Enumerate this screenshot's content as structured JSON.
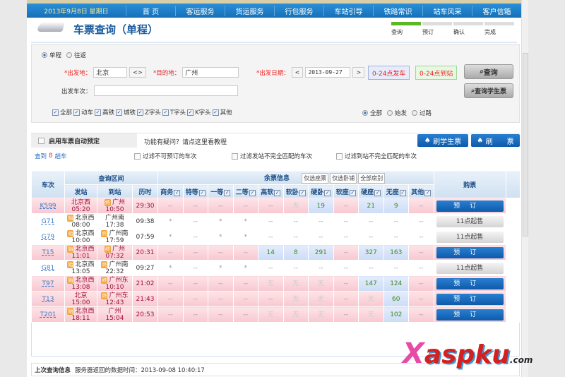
{
  "nav": {
    "date": "2013年9月8日 星期日",
    "items": [
      "首 页",
      "客运服务",
      "货运服务",
      "行包服务",
      "车站引导",
      "铁路常识",
      "站车风采",
      "客户信箱"
    ]
  },
  "header": {
    "title": "车票查询（单程）",
    "steps": [
      "查询",
      "预订",
      "确认",
      "完成"
    ]
  },
  "form": {
    "trip_one": "单程",
    "trip_round": "往返",
    "from_label": "*出发地：",
    "from_value": "北京",
    "swap": "<>",
    "to_label": "*目的地：",
    "to_value": "广州",
    "date_label": "*出发日期：",
    "prev": "<",
    "date_value": "2013-09-27",
    "next": ">",
    "depart_range": "0-24点发车",
    "arrive_range": "0-24点到站",
    "search": "查询",
    "search_student": "查询学生票",
    "train_no_label": "出发车次：",
    "train_no_value": "",
    "types": [
      "全部",
      "动车",
      "高铁",
      "城铁",
      "Z字头",
      "T字头",
      "K字头",
      "其他"
    ],
    "station_opts": [
      "全部",
      "始发",
      "过路"
    ]
  },
  "bar": {
    "auto_book": "启用车票自动预定",
    "help": "功能有疑问？请点这里看教程",
    "refresh_student": "刷学生票",
    "refresh": "刷　　票"
  },
  "filter": {
    "found_prefix": "查到",
    "found_count": "8",
    "found_suffix": "趟车",
    "f1": "过滤不可预订的车次",
    "f2": "过滤发站不完全匹配的车次",
    "f3": "过滤到站不完全匹配的车次"
  },
  "table": {
    "h_train": "车次",
    "h_range": "查询区间",
    "h_from": "发站",
    "h_to": "到站",
    "h_dur": "历时",
    "h_seats": "余票信息",
    "only_seat": "仅选座票",
    "only_sleeper": "仅选卧铺",
    "all_seats": "全部席别",
    "h_buy": "购票",
    "seat_types": [
      "商务",
      "特等",
      "一等",
      "二等",
      "高软",
      "软卧",
      "硬卧",
      "软座",
      "硬座",
      "无座",
      "其他"
    ],
    "rows": [
      {
        "code": "K599",
        "style": "pink",
        "from": "北京西",
        "from_badge": "",
        "dep": "05:20",
        "to": "广州",
        "to_badge": "终",
        "arr": "10:50",
        "dur": "29:30",
        "seats": [
          "--",
          "--",
          "--",
          "--",
          "--",
          "无",
          "19",
          "--",
          "21",
          "9",
          "--"
        ],
        "action": "预订"
      },
      {
        "code": "G71",
        "style": "white",
        "from": "北京西",
        "from_badge": "始",
        "dep": "08:00",
        "to": "广州南",
        "to_badge": "",
        "arr": "17:38",
        "dur": "09:38",
        "seats": [
          "*",
          "--",
          "*",
          "*",
          "--",
          "--",
          "--",
          "--",
          "--",
          "--",
          "--"
        ],
        "action": "11点起售"
      },
      {
        "code": "G79",
        "style": "white",
        "from": "北京西",
        "from_badge": "始",
        "dep": "10:00",
        "to": "广州南",
        "to_badge": "终",
        "arr": "17:59",
        "dur": "07:59",
        "seats": [
          "*",
          "--",
          "*",
          "*",
          "--",
          "--",
          "--",
          "--",
          "--",
          "--",
          "--"
        ],
        "action": "11点起售"
      },
      {
        "code": "T15",
        "style": "pink",
        "from": "北京西",
        "from_badge": "始",
        "dep": "11:01",
        "to": "广州",
        "to_badge": "终",
        "arr": "07:32",
        "dur": "20:31",
        "seats": [
          "--",
          "--",
          "--",
          "--",
          "14",
          "8",
          "291",
          "--",
          "327",
          "163",
          "--"
        ],
        "action": "预订"
      },
      {
        "code": "G81",
        "style": "white",
        "from": "北京西",
        "from_badge": "始",
        "dep": "13:05",
        "to": "广州南",
        "to_badge": "终",
        "arr": "22:32",
        "dur": "09:27",
        "seats": [
          "*",
          "--",
          "*",
          "*",
          "--",
          "--",
          "--",
          "--",
          "--",
          "--",
          "--"
        ],
        "action": "11点起售"
      },
      {
        "code": "T97",
        "style": "pink",
        "from": "北京西",
        "from_badge": "始",
        "dep": "13:08",
        "to": "广州东",
        "to_badge": "终",
        "arr": "10:10",
        "dur": "21:02",
        "seats": [
          "--",
          "--",
          "--",
          "--",
          "无",
          "无",
          "无",
          "--",
          "147",
          "124",
          "--"
        ],
        "action": "预订"
      },
      {
        "code": "T13",
        "style": "pink",
        "from": "北京",
        "from_badge": "",
        "dep": "15:00",
        "to": "广州东",
        "to_badge": "终",
        "arr": "12:43",
        "dur": "21:43",
        "seats": [
          "--",
          "--",
          "--",
          "--",
          "--",
          "无",
          "无",
          "--",
          "无",
          "60",
          "--"
        ],
        "action": "预订"
      },
      {
        "code": "T201",
        "style": "pink",
        "from": "北京西",
        "from_badge": "始",
        "dep": "18:11",
        "to": "广州",
        "to_badge": "",
        "arr": "15:04",
        "dur": "20:53",
        "seats": [
          "--",
          "--",
          "--",
          "--",
          "无",
          "无",
          "无",
          "--",
          "无",
          "102",
          "--"
        ],
        "action": "预订"
      }
    ]
  },
  "footer": {
    "label": "上次查询信息",
    "text": "服务器返回的数据时间：2013-09-08 10:40:17"
  },
  "watermark": {
    "text": "Xaspku.com"
  }
}
